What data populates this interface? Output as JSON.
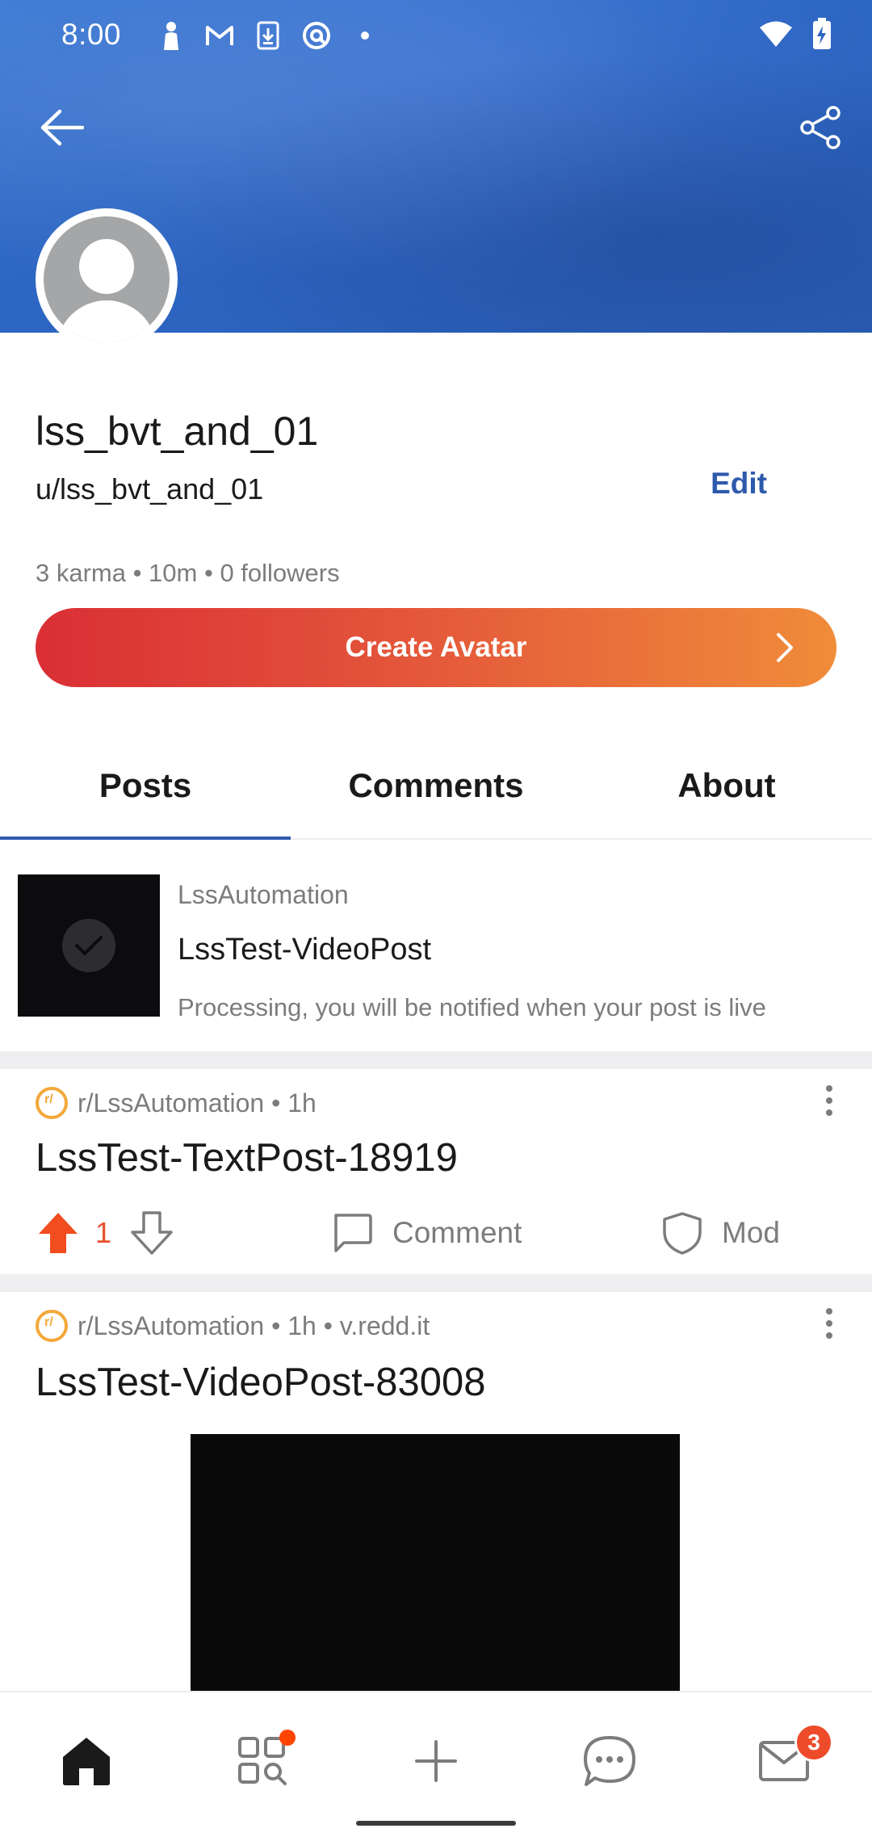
{
  "status_bar": {
    "time": "8:00",
    "left_icons": [
      "person-icon",
      "gmail-icon",
      "download-icon",
      "at-icon",
      "dot-icon"
    ],
    "right_icons": [
      "wifi-icon",
      "battery-charging-icon"
    ]
  },
  "header": {
    "back_icon": "arrow-left-icon",
    "share_icon": "share-icon"
  },
  "profile": {
    "display_name": "lss_bvt_and_01",
    "username": "u/lss_bvt_and_01",
    "edit_label": "Edit",
    "stats": "3 karma • 10m • 0 followers",
    "create_avatar_label": "Create Avatar"
  },
  "tabs": [
    {
      "label": "Posts",
      "active": true
    },
    {
      "label": "Comments",
      "active": false
    },
    {
      "label": "About",
      "active": false
    }
  ],
  "processing_post": {
    "community": "LssAutomation",
    "title": "LssTest-VideoPost",
    "note": "Processing, you will be notified when your post is live"
  },
  "posts": [
    {
      "meta": "r/LssAutomation • 1h",
      "title": "LssTest-TextPost-18919",
      "vote_count": "1",
      "comment_label": "Comment",
      "mod_label": "Mod"
    },
    {
      "meta": "r/LssAutomation • 1h • v.redd.it",
      "title": "LssTest-VideoPost-83008"
    }
  ],
  "bottom_nav": {
    "items": [
      "home-icon",
      "discover-icon",
      "create-post-icon",
      "chat-icon",
      "inbox-icon"
    ],
    "inbox_badge": "3"
  },
  "colors": {
    "banner_blue": "#2d66c3",
    "accent_blue": "#2e5aac",
    "upvote_orange": "#e6502c",
    "gradient_start": "#da2f35",
    "gradient_end": "#f08c3a"
  }
}
